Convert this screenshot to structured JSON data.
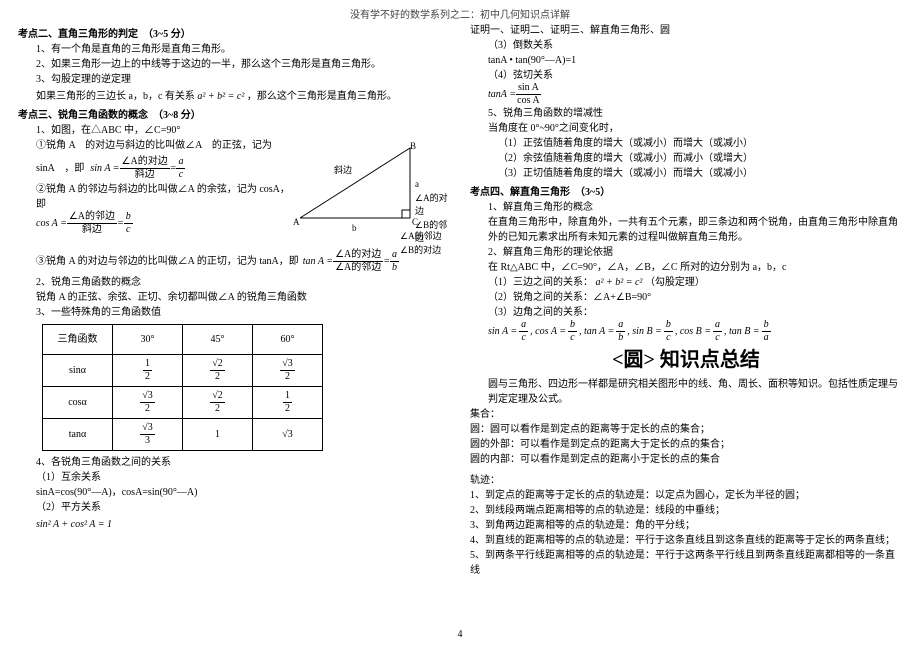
{
  "doc_header": "没有学不好的数学系列之二：初中几何知识点详解",
  "page_number": "4",
  "sec2": {
    "title": "考点二、直角三角形的判定　（3~5 分）",
    "p1": "1、有一个角是直角的三角形是直角三角形。",
    "p2": "2、如果三角形一边上的中线等于这边的一半，那么这个三角形是直角三角形。",
    "p3": "3、勾股定理的逆定理",
    "p4_pre": "如果三角形的三边长 a，b，c 有关系",
    "p4_math": "a² + b² = c²",
    "p4_post": "，那么这个三角形是直角三角形。"
  },
  "sec3": {
    "title": "考点三、锐角三角函数的概念　（3~8 分）",
    "p1": "1、如图，在△ABC 中，∠C=90°",
    "p2_pre": "①锐角 A　的对边与斜边的比叫做∠A　的正弦，记为",
    "p2_sinA": "sinA　，即",
    "eq1_lhs": "sin A =",
    "eq1_num": "∠A的对边",
    "eq1_den": "斜边",
    "eq1_rhs_num": "a",
    "eq1_rhs_den": "c",
    "p3_pre": "②锐角 A 的邻边与斜边的比叫做∠A 的余弦，记为 cosA，即",
    "eq2_lhs": "cos A =",
    "eq2_num": "∠A的邻边",
    "eq2_den": "斜边",
    "eq2_rhs_num": "b",
    "eq2_rhs_den": "c",
    "p4_pre": "③锐角 A 的对边与邻边的比叫做∠A 的正切，记为 tanA，即",
    "eq3_lhs": "tan A =",
    "eq3_num": "∠A的对边",
    "eq3_den": "∠A的邻边",
    "eq3_rhs_num": "a",
    "eq3_rhs_den": "b",
    "p5": "2、锐角三角函数的概念",
    "p6": "锐角 A 的正弦、余弦、正切、余切都叫做∠A 的锐角三角函数",
    "p7": "3、一些特殊角的三角函数值",
    "table": {
      "head": [
        "三角函数",
        "30°",
        "45°",
        "60°"
      ],
      "r1": [
        "sinα",
        "1/2",
        "√2/2",
        "√3/2"
      ],
      "r2": [
        "cosα",
        "√3/2",
        "√2/2",
        "1/2"
      ],
      "r3": [
        "tanα",
        "√3/3",
        "1",
        "√3"
      ]
    },
    "p8": "4、各锐角三角函数之间的关系",
    "p9": "（1）互余关系",
    "p10": "sinA=cos(90°—A)，cosA=sin(90°—A)",
    "p11": "（2）平方关系",
    "p12": "sin² A + cos² A = 1",
    "tri_labels": {
      "A": "A",
      "B": "B",
      "C": "C",
      "b": "b",
      "hyp": "斜边",
      "opp": "a",
      "opp_line1": "∠A的对边",
      "opp_line2": "∠B的邻边",
      "adj_line1": "∠A的邻边",
      "adj_line2": "∠B的对边"
    }
  },
  "sec3r": {
    "cont": "证明一、证明二、证明三、解直角三角形、圆",
    "p1": "（3）倒数关系",
    "p2": "tanA • tan(90°—A)=1",
    "p3": "（4）弦切关系",
    "p4_lhs": "tanA =",
    "p4_num": "sin A",
    "p4_den": "cos A",
    "p5": "5、锐角三角函数的增减性",
    "p6": "当角度在 0°~90°之间变化时，",
    "p7": "（1）正弦值随着角度的增大（或减小）而增大（或减小）",
    "p8": "（2）余弦值随着角度的增大（或减小）而减小（或增大）",
    "p9": "（3）正切值随着角度的增大（或减小）而增大（或减小）"
  },
  "sec4": {
    "title": "考点四、解直角三角形　（3~5）",
    "p1": "1、解直角三角形的概念",
    "p2": "在直角三角形中，除直角外，一共有五个元素，即三条边和两个锐角，由直角三角形中除直角外的已知元素求出所有未知元素的过程叫做解直角三角形。",
    "p3": "2、解直角三角形的理论依据",
    "p4": "在 Rt△ABC 中，∠C=90°，∠A，∠B，∠C 所对的边分别为 a，b，c",
    "p5_pre": "（1）三边之间的关系：",
    "p5_math": "a² + b² = c²",
    "p5_post": "（勾股定理）",
    "p6": "（2）锐角之间的关系：∠A+∠B=90°",
    "p7": "（3）边角之间的关系：",
    "eq": {
      "sinA": [
        "a",
        "c"
      ],
      "cosA": [
        "b",
        "c"
      ],
      "tanA": [
        "a",
        "b"
      ],
      "sinB": [
        "b",
        "c"
      ],
      "cosB": [
        "a",
        "c"
      ],
      "tanB": [
        "b",
        "a"
      ]
    }
  },
  "circle": {
    "title": "<圆> 知识点总结",
    "intro": "圆与三角形、四边形一样都是研究相关图形中的线、角、周长、面积等知识。包括性质定理与判定定理及公式。",
    "set_head": "集合：",
    "set1": "圆：圆可以看作是到定点的距离等于定长的点的集合；",
    "set2": "圆的外部：可以看作是到定点的距离大于定长的点的集合；",
    "set3": "圆的内部：可以看作是到定点的距离小于定长的点的集合",
    "track_head": "轨迹：",
    "t1": "1、到定点的距离等于定长的点的轨迹是：以定点为圆心，定长为半径的圆；",
    "t2": "2、到线段两端点距离相等的点的轨迹是：线段的中垂线；",
    "t3": "3、到角两边距离相等的点的轨迹是：角的平分线；",
    "t4": "4、到直线的距离相等的点的轨迹是：平行于这条直线且到这条直线的距离等于定长的两条直线；",
    "t5": "5、到两条平行线距离相等的点的轨迹是：平行于这两条平行线且到两条直线距离都相等的一条直线"
  }
}
